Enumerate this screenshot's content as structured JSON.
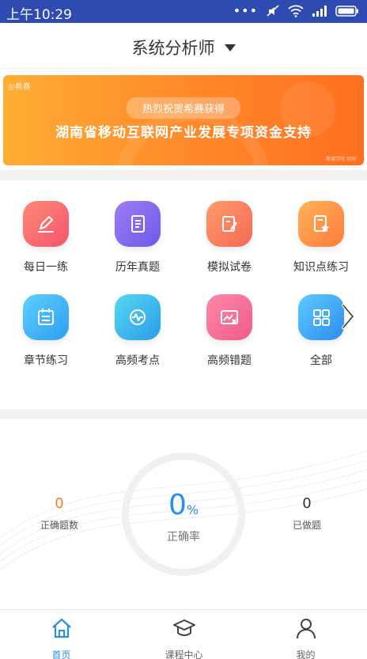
{
  "statusbar": {
    "time": "上午10:29",
    "dots": "•••"
  },
  "header": {
    "title": "系统分析师"
  },
  "banner": {
    "logo": "◎希赛",
    "pill": "热烈祝贺希赛获得",
    "headline": "湖南省移动互联网产业发展专项资金支持",
    "small": "希赛学院 官网"
  },
  "grid": {
    "items": [
      {
        "label": "每日一练",
        "icon": "pencil-icon"
      },
      {
        "label": "历年真题",
        "icon": "document-icon"
      },
      {
        "label": "模拟试卷",
        "icon": "edit-paper-icon"
      },
      {
        "label": "知识点练习",
        "icon": "star-document-icon"
      },
      {
        "label": "章节练习",
        "icon": "calendar-list-icon"
      },
      {
        "label": "高频考点",
        "icon": "pulse-icon"
      },
      {
        "label": "高频错题",
        "icon": "chart-error-icon"
      },
      {
        "label": "全部",
        "icon": "grid-icon"
      }
    ]
  },
  "stats": {
    "correct_count": "0",
    "correct_count_label": "正确题数",
    "rate_value": "0",
    "rate_unit": "%",
    "rate_label": "正确率",
    "done_count": "0",
    "done_label": "已做题"
  },
  "nav": {
    "items": [
      {
        "label": "首页",
        "icon": "home-icon"
      },
      {
        "label": "课程中心",
        "icon": "graduation-cap-icon"
      },
      {
        "label": "我的",
        "icon": "user-icon"
      }
    ]
  },
  "colors": {
    "statusbar": "#2d4bb0",
    "accent": "#2a8ee6",
    "orange": "#f57c26"
  }
}
